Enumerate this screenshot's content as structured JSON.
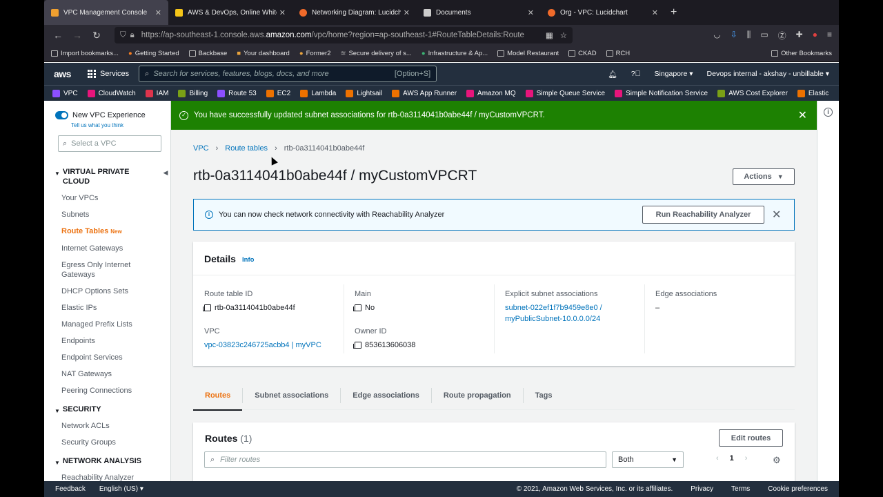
{
  "browser": {
    "tabs": [
      {
        "title": "VPC Management Console",
        "color": "#f0a030",
        "active": true
      },
      {
        "title": "AWS & DevOps, Online Whiteboa",
        "color": "#f5c518",
        "active": false
      },
      {
        "title": "Networking Diagram: Lucidchart",
        "color": "#f06a2a",
        "active": false
      },
      {
        "title": "Documents",
        "color": "#cccccc",
        "active": false
      },
      {
        "title": "Org - VPC: Lucidchart",
        "color": "#f06a2a",
        "active": false
      }
    ],
    "url_prefix": "https://ap-southeast-1.console.aws.",
    "url_domain": "amazon.com",
    "url_suffix": "/vpc/home?region=ap-southeast-1#RouteTableDetails:Route",
    "bookmarks": [
      "Import bookmarks...",
      "Getting Started",
      "Backbase",
      "Your dashboard",
      "Former2",
      "Secure delivery of s...",
      "Infrastructure & Ap...",
      "Model Restaurant",
      "CKAD",
      "RCH"
    ],
    "other_bookmarks": "Other Bookmarks"
  },
  "aws": {
    "logo": "aws",
    "services_label": "Services",
    "search_placeholder": "Search for services, features, blogs, docs, and more",
    "search_shortcut": "[Option+S]",
    "region": "Singapore ▾",
    "account": "Devops internal - akshay - unbillable ▾",
    "favorites": [
      {
        "label": "VPC",
        "color": "#8c4fff"
      },
      {
        "label": "CloudWatch",
        "color": "#e7157b"
      },
      {
        "label": "IAM",
        "color": "#dd344c"
      },
      {
        "label": "Billing",
        "color": "#7aa116"
      },
      {
        "label": "Route 53",
        "color": "#8c4fff"
      },
      {
        "label": "EC2",
        "color": "#ed7100"
      },
      {
        "label": "Lambda",
        "color": "#ed7100"
      },
      {
        "label": "Lightsail",
        "color": "#ed7100"
      },
      {
        "label": "AWS App Runner",
        "color": "#ed7100"
      },
      {
        "label": "Amazon MQ",
        "color": "#e7157b"
      },
      {
        "label": "Simple Queue Service",
        "color": "#e7157b"
      },
      {
        "label": "Simple Notification Service",
        "color": "#e7157b"
      },
      {
        "label": "AWS Cost Explorer",
        "color": "#7aa116"
      },
      {
        "label": "Elastic",
        "color": "#ed7100"
      }
    ]
  },
  "sidebar": {
    "toggle_label": "New VPC Experience",
    "tell_us": "Tell us what you think",
    "select_vpc_placeholder": "Select a VPC",
    "sections": [
      {
        "title": "VIRTUAL PRIVATE CLOUD",
        "items": [
          "Your VPCs",
          "Subnets",
          "Route Tables",
          "Internet Gateways",
          "Egress Only Internet Gateways",
          "DHCP Options Sets",
          "Elastic IPs",
          "Managed Prefix Lists",
          "Endpoints",
          "Endpoint Services",
          "NAT Gateways",
          "Peering Connections"
        ]
      },
      {
        "title": "SECURITY",
        "items": [
          "Network ACLs",
          "Security Groups"
        ]
      },
      {
        "title": "NETWORK ANALYSIS",
        "items": [
          "Reachability Analyzer"
        ]
      }
    ],
    "new_badge": "New"
  },
  "flash": {
    "message": "You have successfully updated subnet associations for rtb-0a3114041b0abe44f / myCustomVPCRT."
  },
  "breadcrumb": [
    "VPC",
    "Route tables",
    "rtb-0a3114041b0abe44f"
  ],
  "page_title": "rtb-0a3114041b0abe44f / myCustomVPCRT",
  "actions_label": "Actions",
  "info_banner": {
    "text": "You can now check network connectivity with Reachability Analyzer",
    "button": "Run Reachability Analyzer"
  },
  "details": {
    "heading": "Details",
    "info": "Info",
    "route_table_id_label": "Route table ID",
    "route_table_id": "rtb-0a3114041b0abe44f",
    "vpc_label": "VPC",
    "vpc": "vpc-03823c246725acbb4 | myVPC",
    "main_label": "Main",
    "main": "No",
    "owner_label": "Owner ID",
    "owner": "853613606038",
    "explicit_label": "Explicit subnet associations",
    "explicit_line1": "subnet-022ef1f7b9459e8e0 /",
    "explicit_line2": "myPublicSubnet-10.0.0.0/24",
    "edge_label": "Edge associations",
    "edge": "–"
  },
  "tabs": [
    "Routes",
    "Subnet associations",
    "Edge associations",
    "Route propagation",
    "Tags"
  ],
  "routes": {
    "heading": "Routes",
    "count": "(1)",
    "edit_button": "Edit routes",
    "filter_placeholder": "Filter routes",
    "filter_select": "Both",
    "page": "1"
  },
  "footer": {
    "feedback": "Feedback",
    "language": "English (US) ▾",
    "copyright": "© 2021, Amazon Web Services, Inc. or its affiliates.",
    "privacy": "Privacy",
    "terms": "Terms",
    "cookies": "Cookie preferences"
  }
}
